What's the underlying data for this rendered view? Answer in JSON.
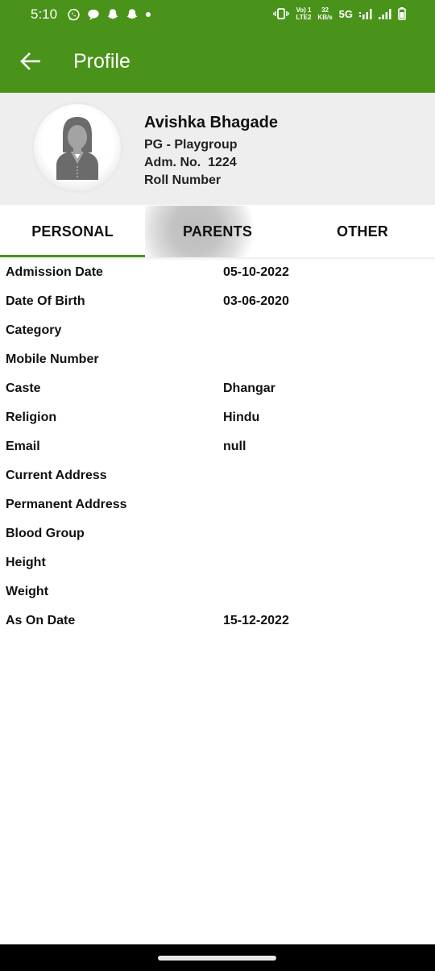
{
  "status_bar": {
    "time": "5:10",
    "notification_icons": [
      "whatsapp-icon",
      "chat-bubble-icon",
      "snapchat-icon",
      "snapchat-icon",
      "dot-icon"
    ],
    "volte_top": "Vo) 1",
    "volte_bottom": "LTE2",
    "speed_top": "32",
    "speed_bottom": "KB/s",
    "network": "5G"
  },
  "app_bar": {
    "title": "Profile",
    "back_icon": "arrow-left-icon"
  },
  "profile": {
    "name": "Avishka Bhagade",
    "class": "PG - Playgroup",
    "admission_no": "Adm. No.  1224",
    "roll_number": "Roll Number"
  },
  "tabs": [
    {
      "label": "PERSONAL",
      "active": true
    },
    {
      "label": "PARENTS",
      "active": false
    },
    {
      "label": "OTHER",
      "active": false
    }
  ],
  "personal_details": [
    {
      "label": "Admission Date",
      "value": "05-10-2022"
    },
    {
      "label": "Date Of Birth",
      "value": "03-06-2020"
    },
    {
      "label": "Category",
      "value": ""
    },
    {
      "label": "Mobile Number",
      "value": ""
    },
    {
      "label": "Caste",
      "value": "Dhangar"
    },
    {
      "label": "Religion",
      "value": "Hindu"
    },
    {
      "label": "Email",
      "value": "null"
    },
    {
      "label": "Current Address",
      "value": ""
    },
    {
      "label": "Permanent Address",
      "value": ""
    },
    {
      "label": "Blood Group",
      "value": ""
    },
    {
      "label": "Height",
      "value": ""
    },
    {
      "label": "Weight",
      "value": ""
    },
    {
      "label": "As On Date",
      "value": "15-12-2022"
    }
  ],
  "colors": {
    "primary": "#4a931a",
    "header_bg": "#eeeeee",
    "text": "#111111"
  }
}
